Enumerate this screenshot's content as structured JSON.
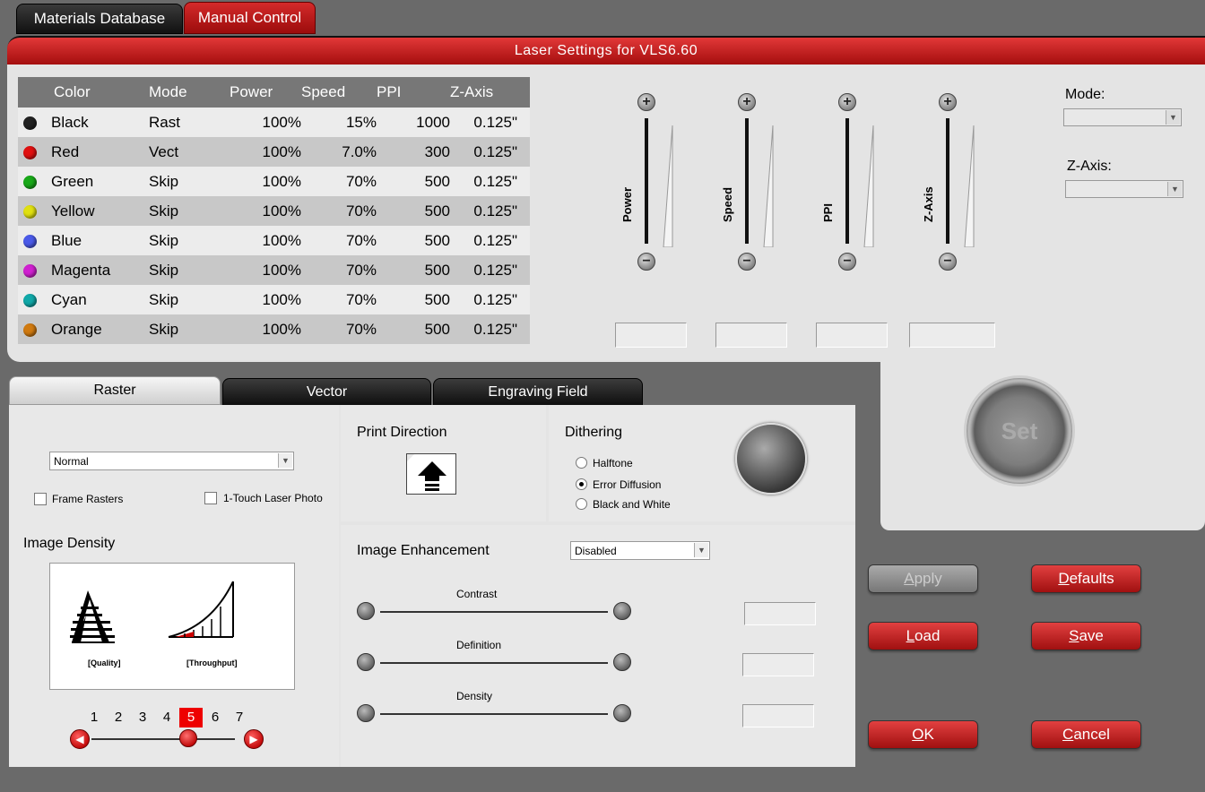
{
  "top_tabs": [
    "Materials Database",
    "Manual Control"
  ],
  "panel_title": "Laser Settings for VLS6.60",
  "table": {
    "headers": [
      "Color",
      "Mode",
      "Power",
      "Speed",
      "PPI",
      "Z-Axis"
    ],
    "rows": [
      {
        "color": "Black",
        "swatch": "#222222",
        "mode": "Rast",
        "power": "100%",
        "speed": "15%",
        "ppi": "1000",
        "z": "0.125\""
      },
      {
        "color": "Red",
        "swatch": "#e01010",
        "mode": "Vect",
        "power": "100%",
        "speed": "7.0%",
        "ppi": "300",
        "z": "0.125\""
      },
      {
        "color": "Green",
        "swatch": "#18a818",
        "mode": "Skip",
        "power": "100%",
        "speed": "70%",
        "ppi": "500",
        "z": "0.125\""
      },
      {
        "color": "Yellow",
        "swatch": "#e0e010",
        "mode": "Skip",
        "power": "100%",
        "speed": "70%",
        "ppi": "500",
        "z": "0.125\""
      },
      {
        "color": "Blue",
        "swatch": "#4a5ae8",
        "mode": "Skip",
        "power": "100%",
        "speed": "70%",
        "ppi": "500",
        "z": "0.125\""
      },
      {
        "color": "Magenta",
        "swatch": "#d020d0",
        "mode": "Skip",
        "power": "100%",
        "speed": "70%",
        "ppi": "500",
        "z": "0.125\""
      },
      {
        "color": "Cyan",
        "swatch": "#10a8a8",
        "mode": "Skip",
        "power": "100%",
        "speed": "70%",
        "ppi": "500",
        "z": "0.125\""
      },
      {
        "color": "Orange",
        "swatch": "#d07a10",
        "mode": "Skip",
        "power": "100%",
        "speed": "70%",
        "ppi": "500",
        "z": "0.125\""
      }
    ]
  },
  "sliders": {
    "power": "Power",
    "speed": "Speed",
    "ppi": "PPI",
    "zaxis": "Z-Axis",
    "plus": "+",
    "minus": "−"
  },
  "right_controls": {
    "mode_label": "Mode:",
    "zaxis_label": "Z-Axis:"
  },
  "set_button": "Set",
  "lower_tabs": [
    "Raster",
    "Vector",
    "Engraving Field"
  ],
  "raster": {
    "mode_select": "Normal",
    "frame_rasters": "Frame Rasters",
    "one_touch": "1-Touch Laser Photo",
    "image_density": "Image Density",
    "quality": "[Quality]",
    "throughput": "[Throughput]",
    "density_levels": [
      "1",
      "2",
      "3",
      "4",
      "5",
      "6",
      "7"
    ],
    "density_selected": 5
  },
  "print_direction": {
    "title": "Print Direction"
  },
  "dithering": {
    "title": "Dithering",
    "options": [
      "Halftone",
      "Error Diffusion",
      "Black and White"
    ],
    "selected": "Error Diffusion"
  },
  "enhancement": {
    "title": "Image Enhancement",
    "select": "Disabled",
    "sliders": [
      "Contrast",
      "Definition",
      "Density"
    ]
  },
  "buttons": {
    "apply": "Apply",
    "defaults": "Defaults",
    "load": "Load",
    "save": "Save",
    "ok": "OK",
    "cancel": "Cancel"
  }
}
